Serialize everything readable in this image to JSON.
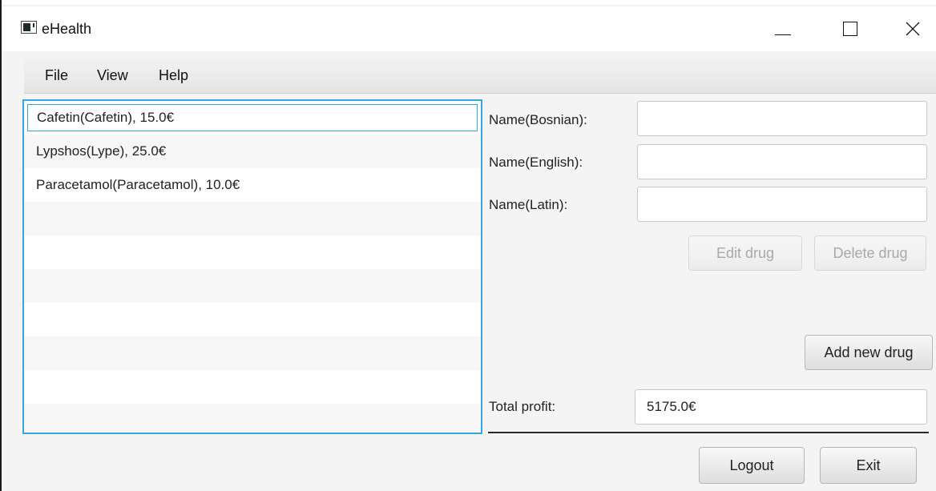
{
  "window": {
    "title": "eHealth"
  },
  "menu": {
    "items": [
      "File",
      "View",
      "Help"
    ]
  },
  "drug_list": {
    "items": [
      "Cafetin(Cafetin), 15.0€",
      "Lypshos(Lype), 25.0€",
      "Paracetamol(Paracetamol), 10.0€"
    ],
    "selected_index": 0
  },
  "form": {
    "name_bosnian_label": "Name(Bosnian):",
    "name_bosnian_value": "",
    "name_english_label": "Name(English):",
    "name_english_value": "",
    "name_latin_label": "Name(Latin):",
    "name_latin_value": ""
  },
  "buttons": {
    "edit_drug": "Edit drug",
    "delete_drug": "Delete drug",
    "add_new_drug": "Add new drug",
    "logout": "Logout",
    "exit": "Exit"
  },
  "profit": {
    "label": "Total profit:",
    "value": "5175.0€"
  },
  "colors": {
    "focus_accent": "#35a7dc"
  }
}
